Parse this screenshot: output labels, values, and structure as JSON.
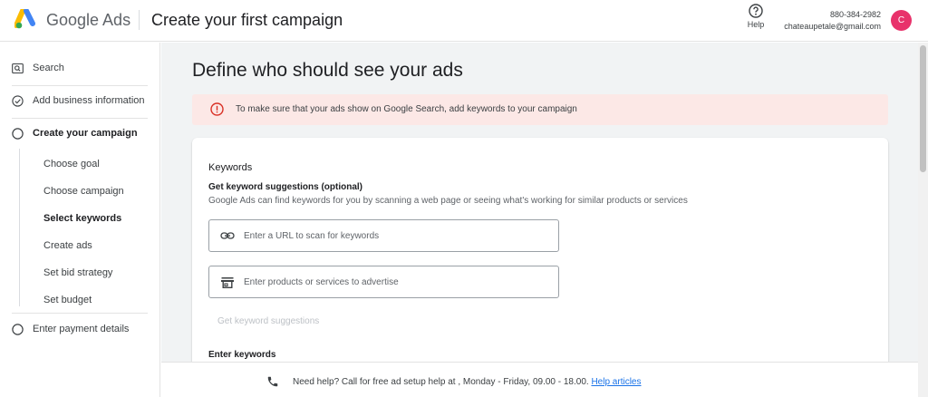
{
  "header": {
    "brand": "Google Ads",
    "title": "Create your first campaign",
    "help_label": "Help",
    "phone": "880-384-2982",
    "email": "chateaupetale@gmail.com",
    "avatar_letter": "C"
  },
  "sidebar": {
    "search": "Search",
    "add_business": "Add business information",
    "create_campaign": "Create your campaign",
    "sub_items": [
      "Choose goal",
      "Choose campaign",
      "Select keywords",
      "Create ads",
      "Set bid strategy",
      "Set budget"
    ],
    "payment": "Enter payment details"
  },
  "main": {
    "title": "Define who should see your ads",
    "alert": "To make sure that your ads show on Google Search, add keywords to your campaign",
    "keywords_title": "Keywords",
    "suggestions_title": "Get keyword suggestions (optional)",
    "suggestions_desc": "Google Ads can find keywords for you by scanning a web page or seeing what's working for similar products or services",
    "url_placeholder": "Enter a URL to scan for keywords",
    "products_placeholder": "Enter products or services to advertise",
    "get_suggestions": "Get keyword suggestions",
    "enter_keywords": "Enter keywords"
  },
  "footer": {
    "text": "Need help? Call for free ad setup help at , Monday - Friday, 09.00 - 18.00.",
    "link": "Help articles"
  },
  "colors": {
    "accent_blue": "#1a73e8",
    "alert_bg": "#fce8e6",
    "alert_icon": "#d93025",
    "avatar": "#e8326b"
  }
}
